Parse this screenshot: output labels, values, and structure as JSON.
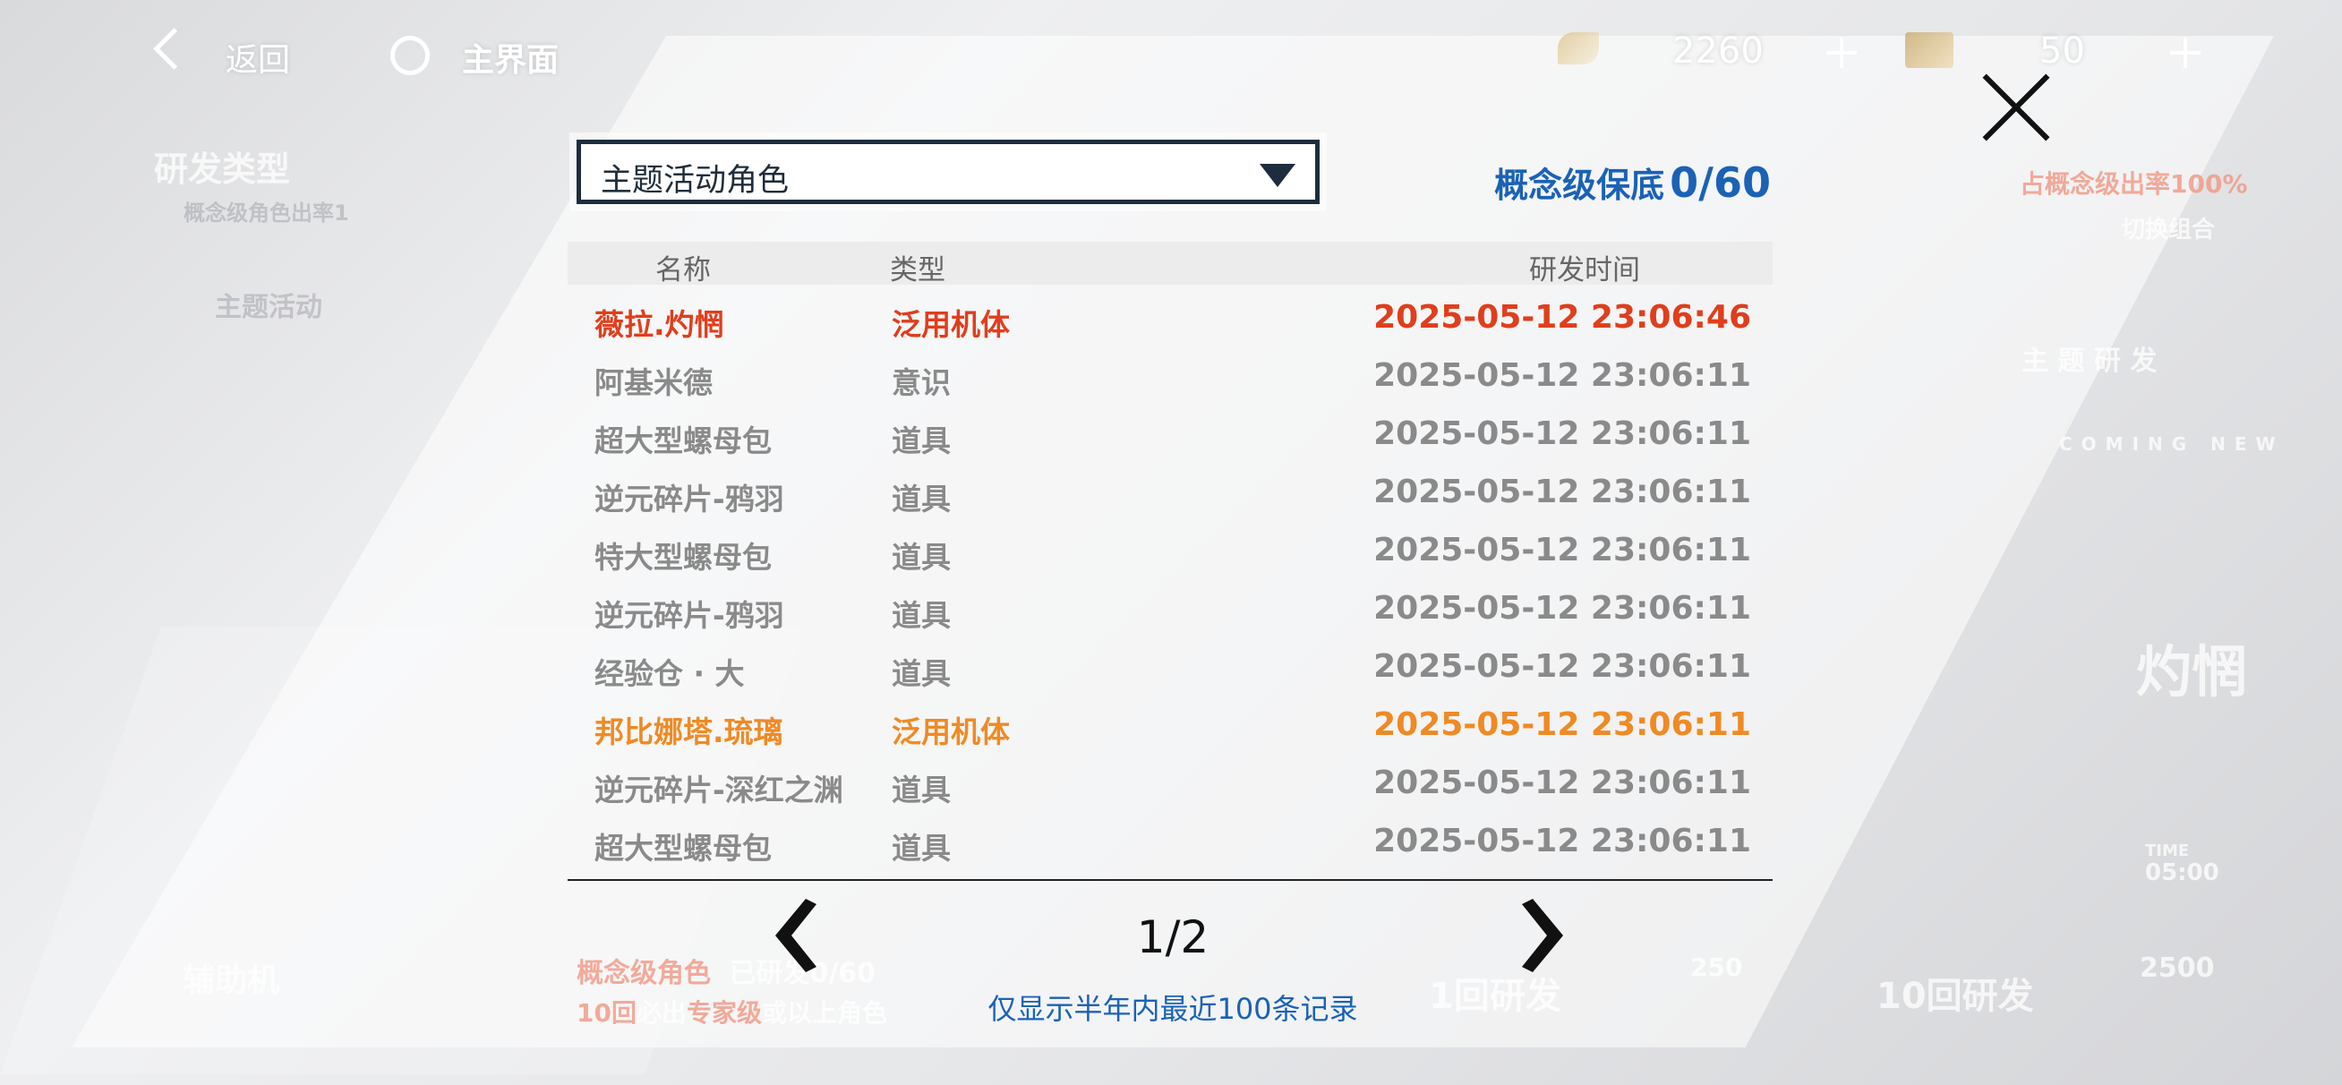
{
  "topbar": {
    "back_label": "返回",
    "home_label": "主界面",
    "currency1_value": "2260",
    "currency2_value": "50"
  },
  "background": {
    "dev_type_label": "研发类型",
    "dev_type_sub": "概念级角色出率1",
    "current_pool": "主题活动",
    "rate_up": "占概念级出率100%",
    "switch_combo": "切换组合",
    "theme_dev": "主 题 研 发",
    "coming_new": "COMING NEW",
    "char_name": "灼惘",
    "aux_label": "辅助机",
    "pity_text_left": "概念级角色",
    "pity_text_mid": "已研发0/60",
    "guarantee_text_left": "10回",
    "guarantee_text_mid": "必出",
    "guarantee_text_right": "专家级",
    "guarantee_text_tail": "或以上角色",
    "single_dev": "1回研发",
    "single_cost": "250",
    "ten_dev": "10回研发",
    "ten_cost": "2500",
    "time_label": "TIME",
    "time_value": "05:00"
  },
  "modal": {
    "dropdown_value": "主题活动角色",
    "pity_label": "概念级保底",
    "pity_value": "0/60",
    "columns": {
      "name": "名称",
      "type": "类型",
      "time": "研发时间"
    },
    "rows": [
      {
        "name": "薇拉.灼惘",
        "type": "泛用机体",
        "time": "2025-05-12 23:06:46",
        "rarity": "red"
      },
      {
        "name": "阿基米德",
        "type": "意识",
        "time": "2025-05-12 23:06:11",
        "rarity": "normal"
      },
      {
        "name": "超大型螺母包",
        "type": "道具",
        "time": "2025-05-12 23:06:11",
        "rarity": "normal"
      },
      {
        "name": "逆元碎片-鸦羽",
        "type": "道具",
        "time": "2025-05-12 23:06:11",
        "rarity": "normal"
      },
      {
        "name": "特大型螺母包",
        "type": "道具",
        "time": "2025-05-12 23:06:11",
        "rarity": "normal"
      },
      {
        "name": "逆元碎片-鸦羽",
        "type": "道具",
        "time": "2025-05-12 23:06:11",
        "rarity": "normal"
      },
      {
        "name": "经验仓 · 大",
        "type": "道具",
        "time": "2025-05-12 23:06:11",
        "rarity": "normal"
      },
      {
        "name": "邦比娜塔.琉璃",
        "type": "泛用机体",
        "time": "2025-05-12 23:06:11",
        "rarity": "orange"
      },
      {
        "name": "逆元碎片-深红之渊",
        "type": "道具",
        "time": "2025-05-12 23:06:11",
        "rarity": "normal"
      },
      {
        "name": "超大型螺母包",
        "type": "道具",
        "time": "2025-05-12 23:06:11",
        "rarity": "normal"
      }
    ],
    "page_indicator": "1/2",
    "note": "仅显示半年内最近100条记录"
  },
  "colors": {
    "accent_blue": "#1a62b6",
    "rarity_red": "#e03e1c",
    "rarity_orange": "#ef8a24",
    "text_gray": "#8a8a8a"
  }
}
